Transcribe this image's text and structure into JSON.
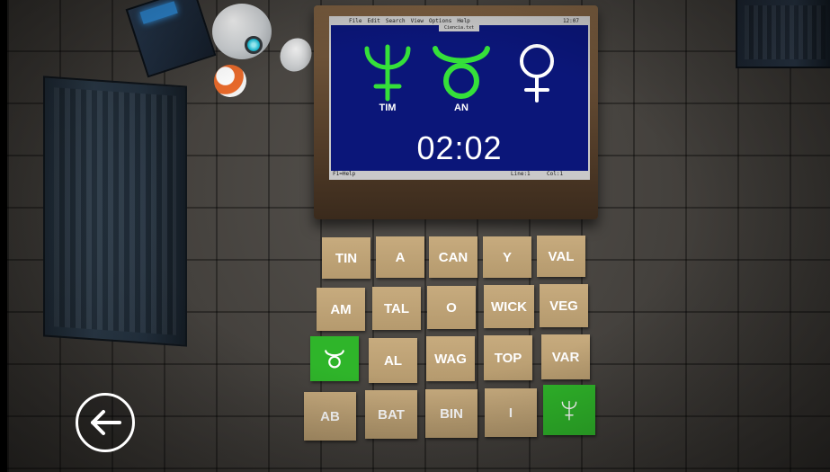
{
  "screen": {
    "menu": [
      "File",
      "Edit",
      "Search",
      "View",
      "Options",
      "Help"
    ],
    "menu_clock": "12:07",
    "file_title": "Ciencia.txt",
    "status_help": "F1=Help",
    "status_line": "Line:1",
    "status_col": "Col:1",
    "symbols": [
      {
        "icon": "neptune-icon",
        "color": "#35e03a",
        "label": "TIM"
      },
      {
        "icon": "taurus-icon",
        "color": "#35e03a",
        "label": "AN"
      },
      {
        "icon": "venus-icon",
        "color": "#ffffff",
        "label": ""
      }
    ],
    "timer": "02:02"
  },
  "tiles": {
    "rows": [
      [
        "TIN",
        "A",
        "CAN",
        "Y",
        "VAL"
      ],
      [
        "AM",
        "TAL",
        "O",
        "WICK",
        "VEG"
      ],
      [
        "taurus-icon",
        "AL",
        "WAG",
        "TOP",
        "VAR"
      ],
      [
        "AB",
        "BAT",
        "BIN",
        "I",
        "neptune-icon"
      ]
    ],
    "selected_color": "#2fb52a",
    "tile_color": "#c0a476"
  },
  "back_button": {
    "icon": "back-arrow-icon"
  }
}
